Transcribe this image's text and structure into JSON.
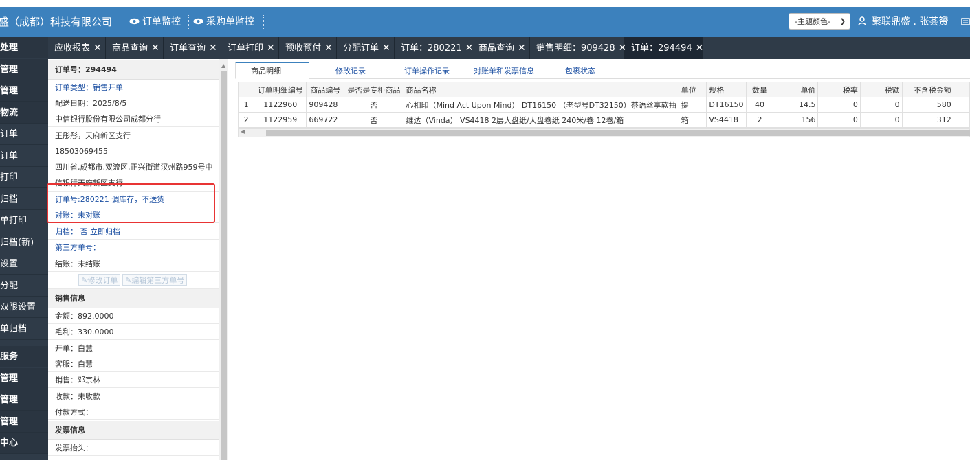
{
  "header": {
    "company": "盛（成都）科技有限公司",
    "links": [
      "订单监控",
      "采购单监控"
    ],
    "theme_label": "-主题颜色-",
    "user": "聚联鼎盛 . 张荟赟"
  },
  "tabs": [
    {
      "label": "应收报表"
    },
    {
      "label": "商品查询"
    },
    {
      "label": "订单查询"
    },
    {
      "label": "订单打印"
    },
    {
      "label": "预收预付"
    },
    {
      "label": "分配订单"
    },
    {
      "label": "订单：280221"
    },
    {
      "label": "商品查询"
    },
    {
      "label": "销售明细：909428"
    },
    {
      "label": "订单：294494"
    }
  ],
  "sidebar": [
    "处理",
    "管理",
    "管理",
    "物流",
    "订单",
    "订单",
    "打印",
    "归档",
    "单打印",
    "归档(新)",
    "设置",
    "分配",
    "双限设置",
    "单归档",
    "服务",
    "管理",
    "管理",
    "管理",
    "中心"
  ],
  "order": {
    "header": "订单号：294494",
    "type": "订单类型：销售开单",
    "date": "配送日期：2025/8/5",
    "company": "中信银行股份有限公司成都分行",
    "contact": "王彤彤，天府新区支行",
    "phone": "18503069455",
    "address": "四川省,成都市,双流区,正兴街道汉州路959号中信银行天府新区支行",
    "note": "订单号:280221 调库存，不送货",
    "reconcile": "对账：未对账",
    "archive": "归档： 否 立即归档",
    "third_party": "第三方单号：",
    "settle": "结账：未结账",
    "btn_edit": "修改订单",
    "btn_edit_third": "编辑第三方单号"
  },
  "sales": {
    "header": "销售信息",
    "amount": "金额：892.0000",
    "profit": "毛利：330.0000",
    "opener": "开单：白慧",
    "service": "客服：白慧",
    "sales": "销售：邓宗林",
    "collect": "收款：未收款",
    "payment": "付款方式："
  },
  "invoice": {
    "header": "发票信息",
    "title": "发票抬头："
  },
  "content_tabs": [
    "商品明细",
    "修改记录",
    "订单操作记录",
    "对账单和发票信息",
    "包裹状态"
  ],
  "table": {
    "columns": [
      "",
      "订单明细编号",
      "商品编号",
      "是否是专柜商品",
      "商品名称",
      "单位",
      "规格",
      "数量",
      "单价",
      "税率",
      "税额",
      "不含税金额"
    ],
    "rows": [
      [
        "1",
        "1122960",
        "909428",
        "否",
        "心相印（Mind Act Upon Mind） DT16150 （老型号DT32150）茶语丝享软抽",
        "提",
        "DT16150",
        "40",
        "14.5",
        "0",
        "0",
        "580"
      ],
      [
        "2",
        "1122959",
        "669722",
        "否",
        "维达（Vinda） VS4418 2层大盘纸/大盘卷纸 240米/卷 12卷/箱",
        "箱",
        "VS4418",
        "2",
        "156",
        "0",
        "0",
        "312"
      ]
    ]
  }
}
